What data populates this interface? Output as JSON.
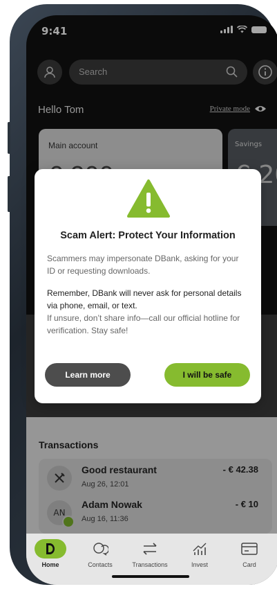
{
  "status_bar": {
    "time": "9:41"
  },
  "search": {
    "placeholder": "Search"
  },
  "greeting": "Hello Tom",
  "private_mode_label": "Private mode",
  "accounts": [
    {
      "label": "Main account",
      "amount": "€ 200 .."
    },
    {
      "label": "Savings",
      "amount": "€ 20"
    }
  ],
  "dialog": {
    "title": "Scam Alert: Protect Your Information",
    "paragraph1": "Scammers may impersonate DBank, asking for your ID or requesting downloads.",
    "paragraph2": "Remember, DBank will never ask for personal details via phone, email, or text.",
    "paragraph3": "If unsure, don’t share info—call our official hotline for verification. Stay safe!",
    "learn_more": "Learn more",
    "confirm": "I will be safe",
    "warning_color": "#86bb2f"
  },
  "transactions": {
    "title": "Transactions",
    "items": [
      {
        "name": "Good restaurant",
        "date": "Aug 26, 12:01",
        "amount": "- € 42.38",
        "icon": "fork-knife-icon"
      },
      {
        "name": "Adam Nowak",
        "date": "Aug 16, 11:36",
        "amount": "- € 10",
        "avatar_initials": "AN"
      }
    ]
  },
  "nav": [
    {
      "label": "Home"
    },
    {
      "label": "Contacts"
    },
    {
      "label": "Transactions"
    },
    {
      "label": "Invest"
    },
    {
      "label": "Card"
    }
  ],
  "colors": {
    "accent": "#86bb2f",
    "dark": "#121212"
  }
}
